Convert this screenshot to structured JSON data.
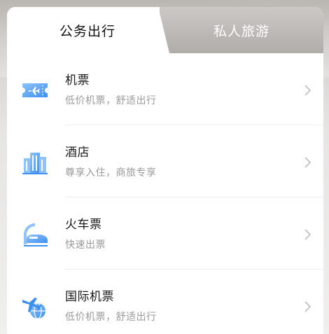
{
  "tabs": {
    "business": "公务出行",
    "private": "私人旅游"
  },
  "items": [
    {
      "title": "机票",
      "subtitle": "低价机票，舒适出行",
      "icon": "plane-ticket-icon"
    },
    {
      "title": "酒店",
      "subtitle": "尊享入住，商旅专享",
      "icon": "hotel-building-icon"
    },
    {
      "title": "火车票",
      "subtitle": "快速出票",
      "icon": "train-icon"
    },
    {
      "title": "国际机票",
      "subtitle": "低价机票，舒适出行",
      "icon": "international-flight-icon"
    }
  ],
  "colors": {
    "accent": "#3d8ff0",
    "accent_light": "#8ec2fb"
  }
}
